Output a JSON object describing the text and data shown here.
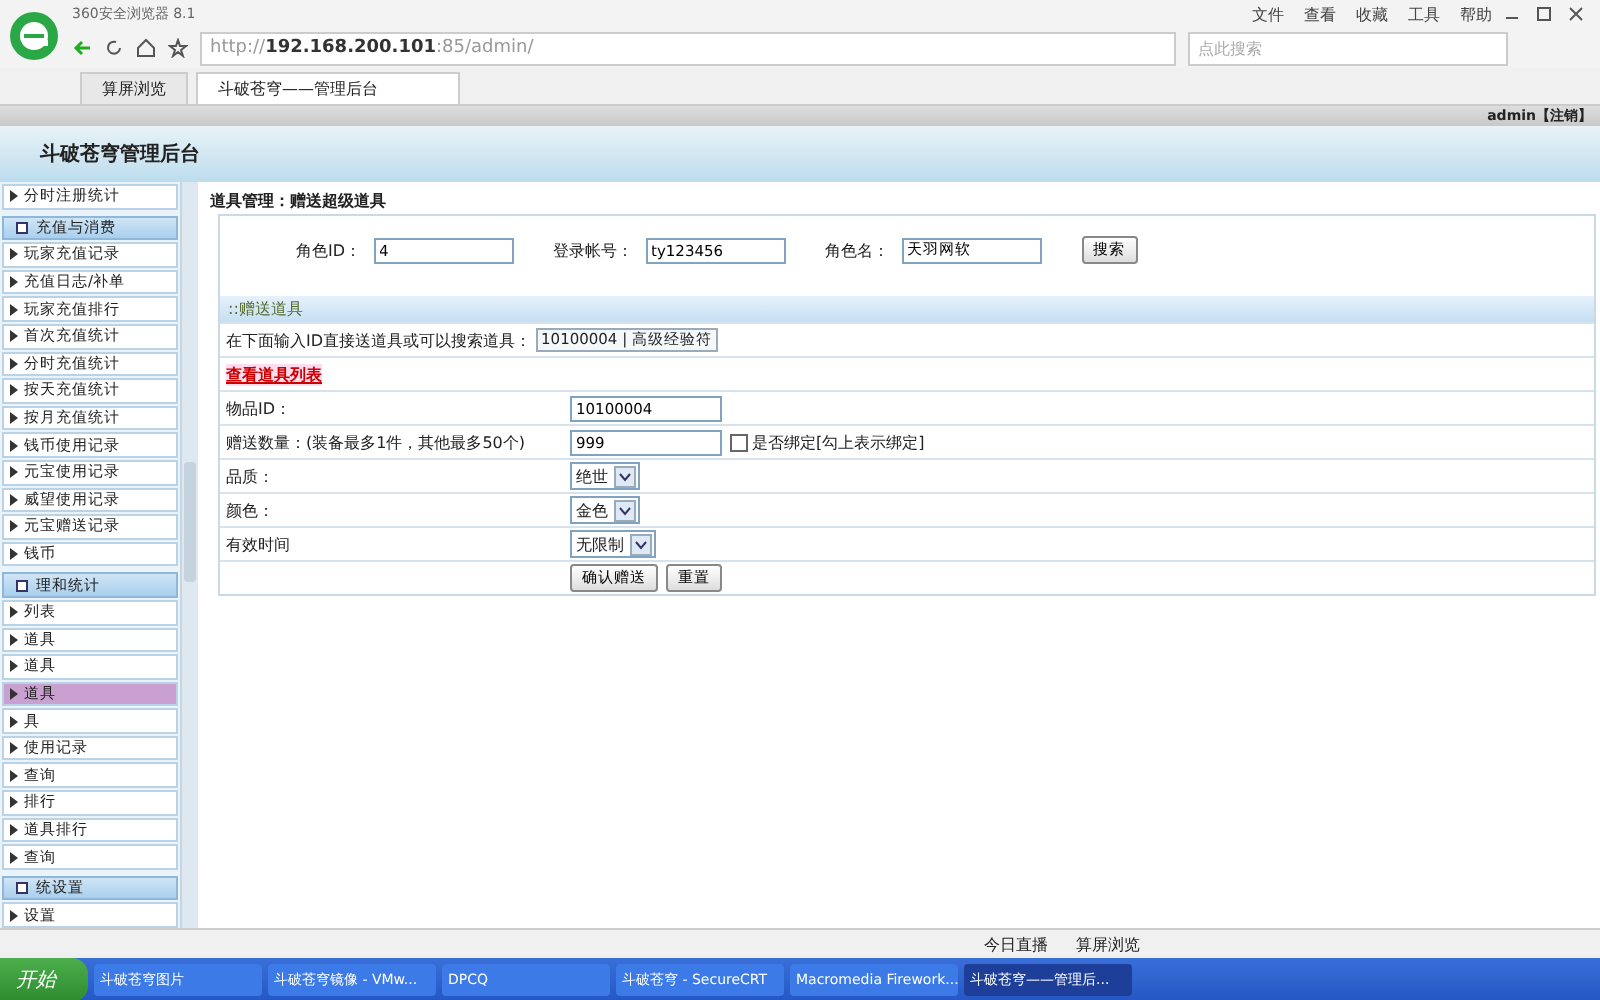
{
  "browser": {
    "name": "360安全浏览器 8.1",
    "menu": [
      "文件",
      "查看",
      "收藏",
      "工具",
      "帮助"
    ],
    "url": "http://**192.168.200.101**:85/admin/",
    "search_placeholder": "点此搜索",
    "tabs": [
      {
        "label": "算屏浏览",
        "selected": false
      },
      {
        "label": "斗破苍穹——管理后台",
        "selected": true
      }
    ],
    "user": "admin【注销】"
  },
  "header": {
    "title": "斗破苍穹管理后台"
  },
  "sidebar": [
    {
      "kind": "item",
      "label": "分时注册统计",
      "selected": false
    },
    {
      "kind": "section",
      "label": "充值与消费"
    },
    {
      "kind": "item",
      "label": "玩家充值记录",
      "selected": false
    },
    {
      "kind": "item",
      "label": "充值日志/补单",
      "selected": false
    },
    {
      "kind": "item",
      "label": "玩家充值排行",
      "selected": false
    },
    {
      "kind": "item",
      "label": "首次充值统计",
      "selected": false
    },
    {
      "kind": "item",
      "label": "分时充值统计",
      "selected": false
    },
    {
      "kind": "item",
      "label": "按天充值统计",
      "selected": false
    },
    {
      "kind": "item",
      "label": "按月充值统计",
      "selected": false
    },
    {
      "kind": "item",
      "label": "钱币使用记录",
      "selected": false
    },
    {
      "kind": "item",
      "label": "元宝使用记录",
      "selected": false
    },
    {
      "kind": "item",
      "label": "威望使用记录",
      "selected": false
    },
    {
      "kind": "item",
      "label": "元宝赠送记录",
      "selected": false
    },
    {
      "kind": "item",
      "label": "钱币",
      "selected": false
    },
    {
      "kind": "section",
      "label": "理和统计"
    },
    {
      "kind": "item",
      "label": "列表",
      "selected": false
    },
    {
      "kind": "item",
      "label": "道具",
      "selected": false
    },
    {
      "kind": "item",
      "label": "道具",
      "selected": false
    },
    {
      "kind": "item",
      "label": "道具",
      "selected": true
    },
    {
      "kind": "item",
      "label": "具",
      "selected": false
    },
    {
      "kind": "item",
      "label": "使用记录",
      "selected": false
    },
    {
      "kind": "item",
      "label": "查询",
      "selected": false
    },
    {
      "kind": "item",
      "label": "排行",
      "selected": false
    },
    {
      "kind": "item",
      "label": "道具排行",
      "selected": false
    },
    {
      "kind": "item",
      "label": "查询",
      "selected": false
    },
    {
      "kind": "section",
      "label": "统设置"
    },
    {
      "kind": "item",
      "label": "设置",
      "selected": false
    }
  ],
  "breadcrumb": "道具管理：赠送超级道具",
  "search": {
    "fields": [
      {
        "label": "角色ID：",
        "value": "4"
      },
      {
        "label": "登录帐号：",
        "value": "ty123456"
      },
      {
        "label": "角色名：",
        "value": "天羽网软"
      }
    ],
    "button": "搜索"
  },
  "section_title": "::赠送道具",
  "quick": {
    "label": "在下面输入ID直接送道具或可以搜索道具：",
    "value": "10100004 | 高级经验符"
  },
  "list_link": "查看道具列表",
  "rows": [
    {
      "kind": "input",
      "label": "物品ID：",
      "value": "10100004"
    },
    {
      "kind": "input",
      "label": "赠送数量：(装备最多1件，其他最多50个)",
      "value": "999",
      "checkbox": {
        "label": "是否绑定[勾上表示绑定]",
        "checked": false
      }
    },
    {
      "kind": "select",
      "label": "品质：",
      "value": "绝世"
    },
    {
      "kind": "select",
      "label": "颜色：",
      "value": "金色"
    },
    {
      "kind": "select",
      "label": "有效时间",
      "value": "无限制"
    },
    {
      "kind": "buttons",
      "buttons": [
        "确认赠送",
        "重置"
      ]
    }
  ],
  "status_bar": [
    "今日直播",
    "算屏浏览"
  ],
  "taskbar": {
    "start": "开始",
    "tasks": [
      {
        "label": "斗破苍穹图片",
        "selected": false
      },
      {
        "label": "斗破苍穹镜像 - VMw...",
        "selected": false
      },
      {
        "label": "DPCQ",
        "selected": false
      },
      {
        "label": "斗破苍穹 - SecureCRT",
        "selected": false
      },
      {
        "label": "Macromedia Firework...",
        "selected": false
      },
      {
        "label": "斗破苍穹——管理后...",
        "selected": true
      }
    ]
  }
}
